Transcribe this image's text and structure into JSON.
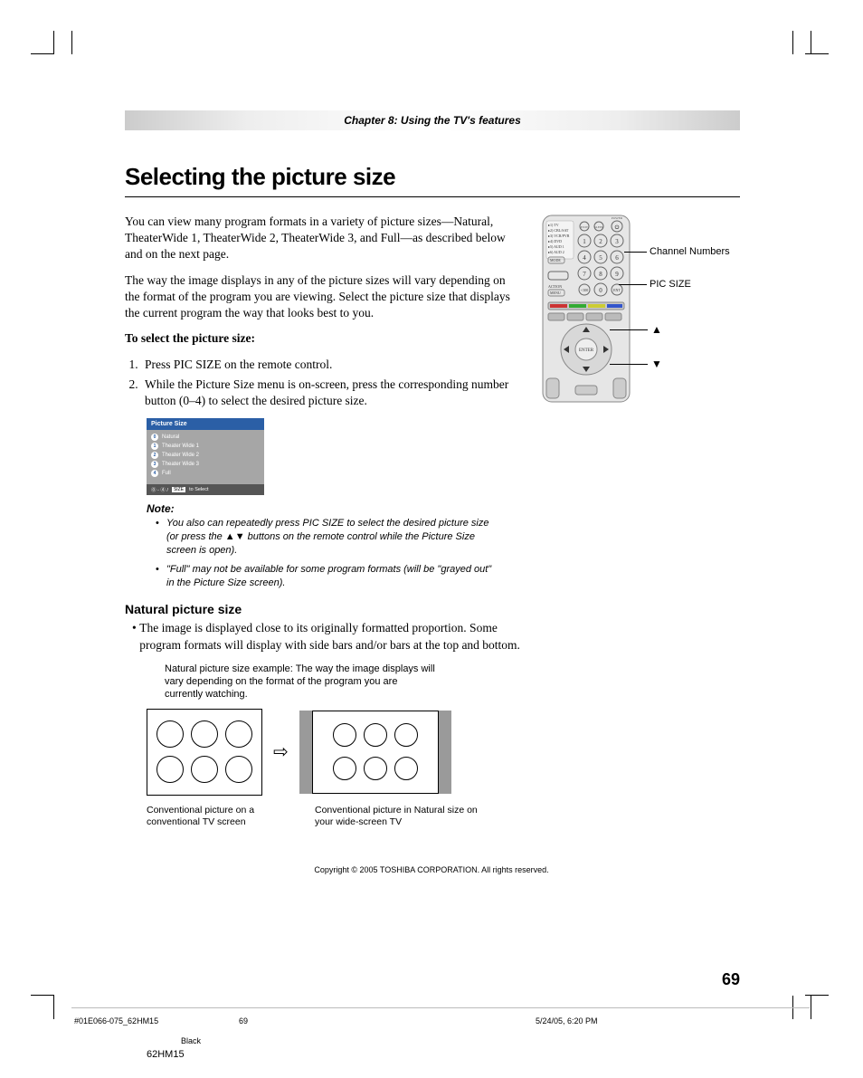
{
  "chapter": "Chapter 8: Using the TV's features",
  "h1": "Selecting the picture size",
  "para1": "You can view many program formats in a variety of picture sizes—Natural, TheaterWide 1, TheaterWide 2, TheaterWide 3, and Full—as described below and on the next page.",
  "para2": "The way the image displays in any of the picture sizes will vary depending on the format of the program you are viewing. Select the picture size that displays the current program the way that looks best to you.",
  "select_heading": "To select the picture size:",
  "steps": [
    "Press PIC SIZE on the remote control.",
    "While the Picture Size menu is on-screen, press the corresponding number button (0–4) to select the desired picture size."
  ],
  "osd": {
    "title": "Picture Size",
    "items": [
      {
        "num": "0",
        "label": "Natural"
      },
      {
        "num": "1",
        "label": "Theater Wide 1"
      },
      {
        "num": "2",
        "label": "Theater Wide 2"
      },
      {
        "num": "3",
        "label": "Theater Wide 3"
      },
      {
        "num": "4",
        "label": "Full"
      }
    ],
    "foot_sizetag": "SIZE",
    "foot_text": "to Select"
  },
  "note_label": "Note:",
  "notes": [
    "You also can repeatedly press PIC SIZE to select the desired picture size (or press the ▲▼ buttons on the remote control while the Picture Size screen is open).",
    "\"Full\" may not be available for some program formats (will be \"grayed out\" in the Picture Size screen)."
  ],
  "h3": "Natural picture size",
  "natural_bullet": "The image is displayed close to its originally formatted proportion. Some program formats will display with side bars and/or bars at the top and bottom.",
  "example_note": "Natural picture size example: The way the image displays will vary depending on the format of the program you are currently watching.",
  "caption1": "Conventional picture on a conventional TV screen",
  "caption2": "Conventional picture in Natural size on your wide-screen TV",
  "remote_callouts": {
    "chnum": "Channel Numbers",
    "picsize": "PIC SIZE",
    "up": "▲",
    "down": "▼"
  },
  "remote_body": {
    "side1": "▸1) TV",
    "side2": "▸2) CBL/SAT",
    "side3": "▸3) VCR/PVR",
    "side4": "▸4) DVD",
    "side5": "▸5) AUD 1",
    "side6": "▸6) AUD 2",
    "mode": "MODE",
    "action": "ACTION",
    "menu": "MENU",
    "enter": "ENTER",
    "power": "POWER",
    "exit": "EXIT",
    "sleep": "SLEEP"
  },
  "copyright": "Copyright © 2005 TOSHIBA CORPORATION. All rights reserved.",
  "pagenum": "69",
  "footer": {
    "left": "#01E066-075_62HM15",
    "mid": "69",
    "right": "5/24/05, 6:20 PM",
    "black": "Black",
    "model": "62HM15"
  }
}
